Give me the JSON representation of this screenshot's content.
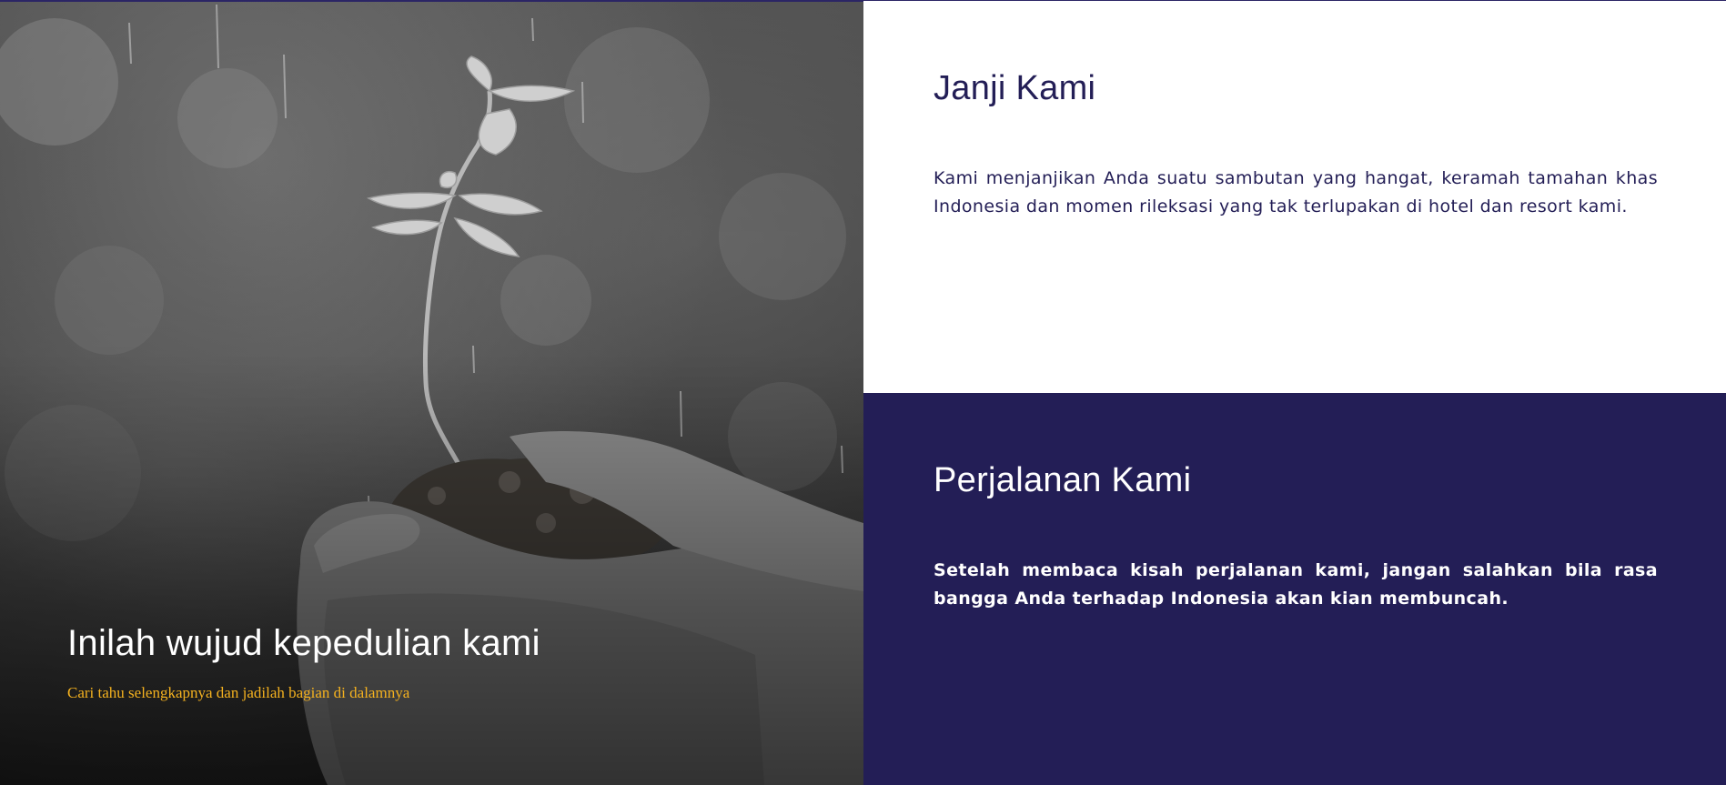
{
  "hero": {
    "title": "Inilah wujud kepedulian kami",
    "subtitle_link": "Cari tahu selengkapnya dan jadilah bagian di dalamnya",
    "image": "hands-holding-seedling-photo"
  },
  "promise": {
    "title": "Janji Kami",
    "body": "Kami menjanjikan Anda suatu sambutan yang hangat, keramah tamahan khas Indonesia dan momen rileksasi yang tak terlupakan di hotel dan resort kami."
  },
  "journey": {
    "title": "Perjalanan Kami",
    "body": "Setelah membaca kisah perjalanan kami, jangan salahkan bila rasa bangga Anda terhadap Indonesia akan kian membuncah."
  },
  "colors": {
    "navy": "#231e56",
    "accent_yellow": "#f5b21f",
    "white": "#ffffff"
  }
}
